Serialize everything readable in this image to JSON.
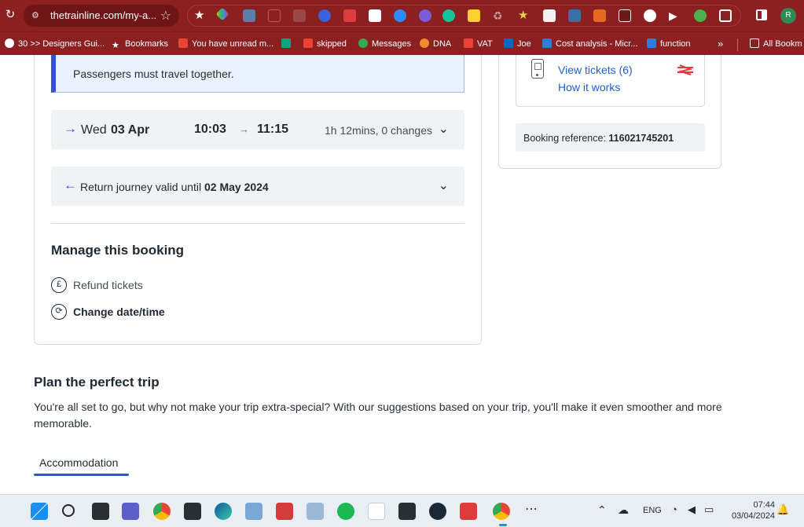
{
  "browser": {
    "url": "thetrainline.com/my-a...",
    "bookmarks": [
      {
        "label": "30 >> Designers Gui..."
      },
      {
        "label": "Bookmarks"
      },
      {
        "label": "You have unread m..."
      },
      {
        "label": ""
      },
      {
        "label": "skipped"
      },
      {
        "label": "Messages"
      },
      {
        "label": "DNA"
      },
      {
        "label": "VAT"
      },
      {
        "label": "Joe"
      },
      {
        "label": "Cost analysis - Micr..."
      },
      {
        "label": "function"
      },
      {
        "label": "»"
      },
      {
        "label": "All Bookm"
      }
    ],
    "profile_initial": "R"
  },
  "booking": {
    "notice": "Passengers must travel together.",
    "outbound": {
      "day": "Wed",
      "date": "03 Apr",
      "depart": "10:03",
      "arrive": "11:15",
      "duration": "1h 12mins, 0 changes"
    },
    "return": {
      "text": "Return journey valid until ",
      "date": "02 May 2024"
    },
    "manage_title": "Manage this booking",
    "refund_label": "Refund tickets",
    "change_label": "Change date/time"
  },
  "tickets": {
    "view_label": "View tickets (6)",
    "how_label": "How it works",
    "booking_ref_label": "Booking reference: ",
    "booking_ref": "116021745201"
  },
  "plan": {
    "title": "Plan the perfect trip",
    "text": "You're all set to go, but why not make your trip extra-special? With our suggestions based on your trip, you'll make it even smoother and more memorable.",
    "tab_label": "Accommodation"
  },
  "taskbar": {
    "language": "ENG",
    "time": "07:44",
    "date": "03/04/2024"
  },
  "colors": {
    "chrome": "#8c1f1f",
    "accent": "#3250d8",
    "link": "#1f5fd1"
  }
}
